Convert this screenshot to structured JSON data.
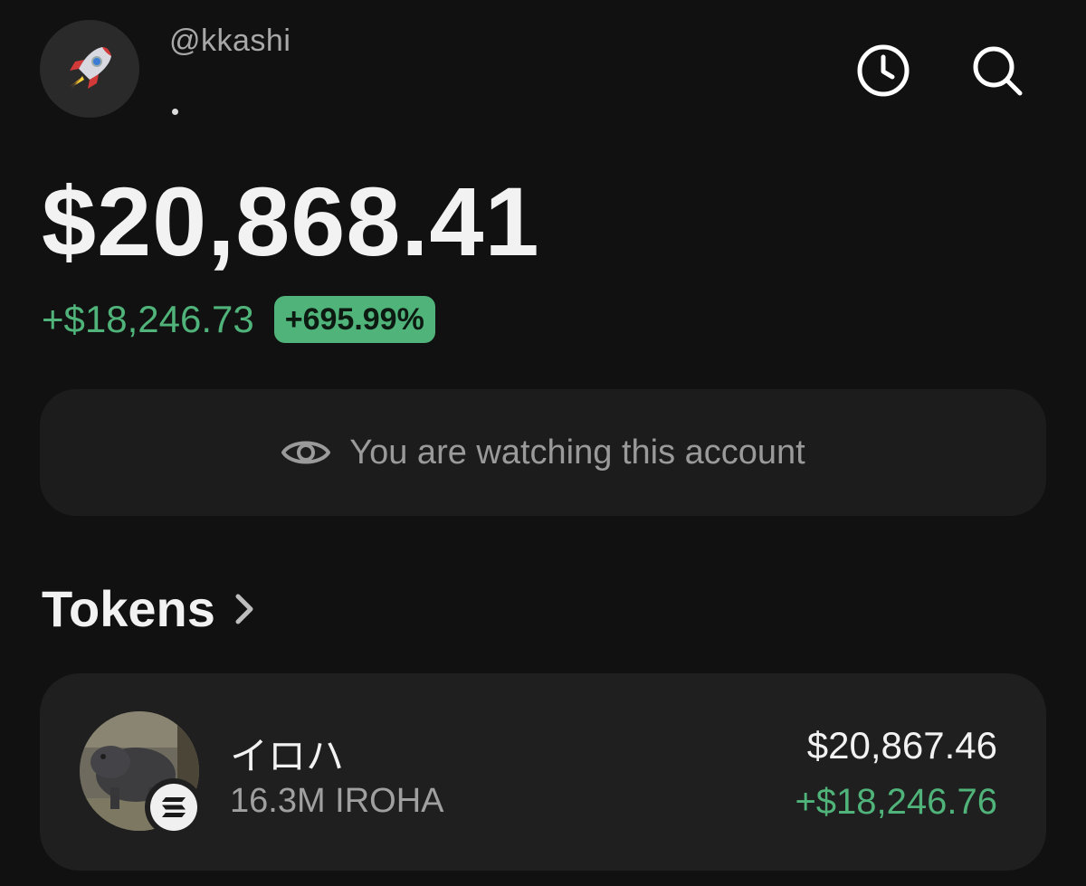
{
  "header": {
    "username": "@kkashi",
    "avatar_icon": "rocket-icon",
    "history_icon": "clock-icon",
    "search_icon": "search-icon"
  },
  "balance": {
    "total": "$20,868.41",
    "change_amount": "+$18,246.73",
    "change_percent": "+695.99%"
  },
  "watch_banner": {
    "icon": "eye-icon",
    "text": "You are watching this account"
  },
  "tokens": {
    "title": "Tokens",
    "chevron_icon": "chevron-right-icon",
    "items": [
      {
        "name": "イロハ",
        "amount": "16.3M IROHA",
        "value": "$20,867.46",
        "change": "+$18,246.76",
        "chain_icon": "solana-icon"
      }
    ]
  },
  "colors": {
    "background": "#111111",
    "positive": "#4fb37a",
    "card": "#1f1f1f"
  }
}
